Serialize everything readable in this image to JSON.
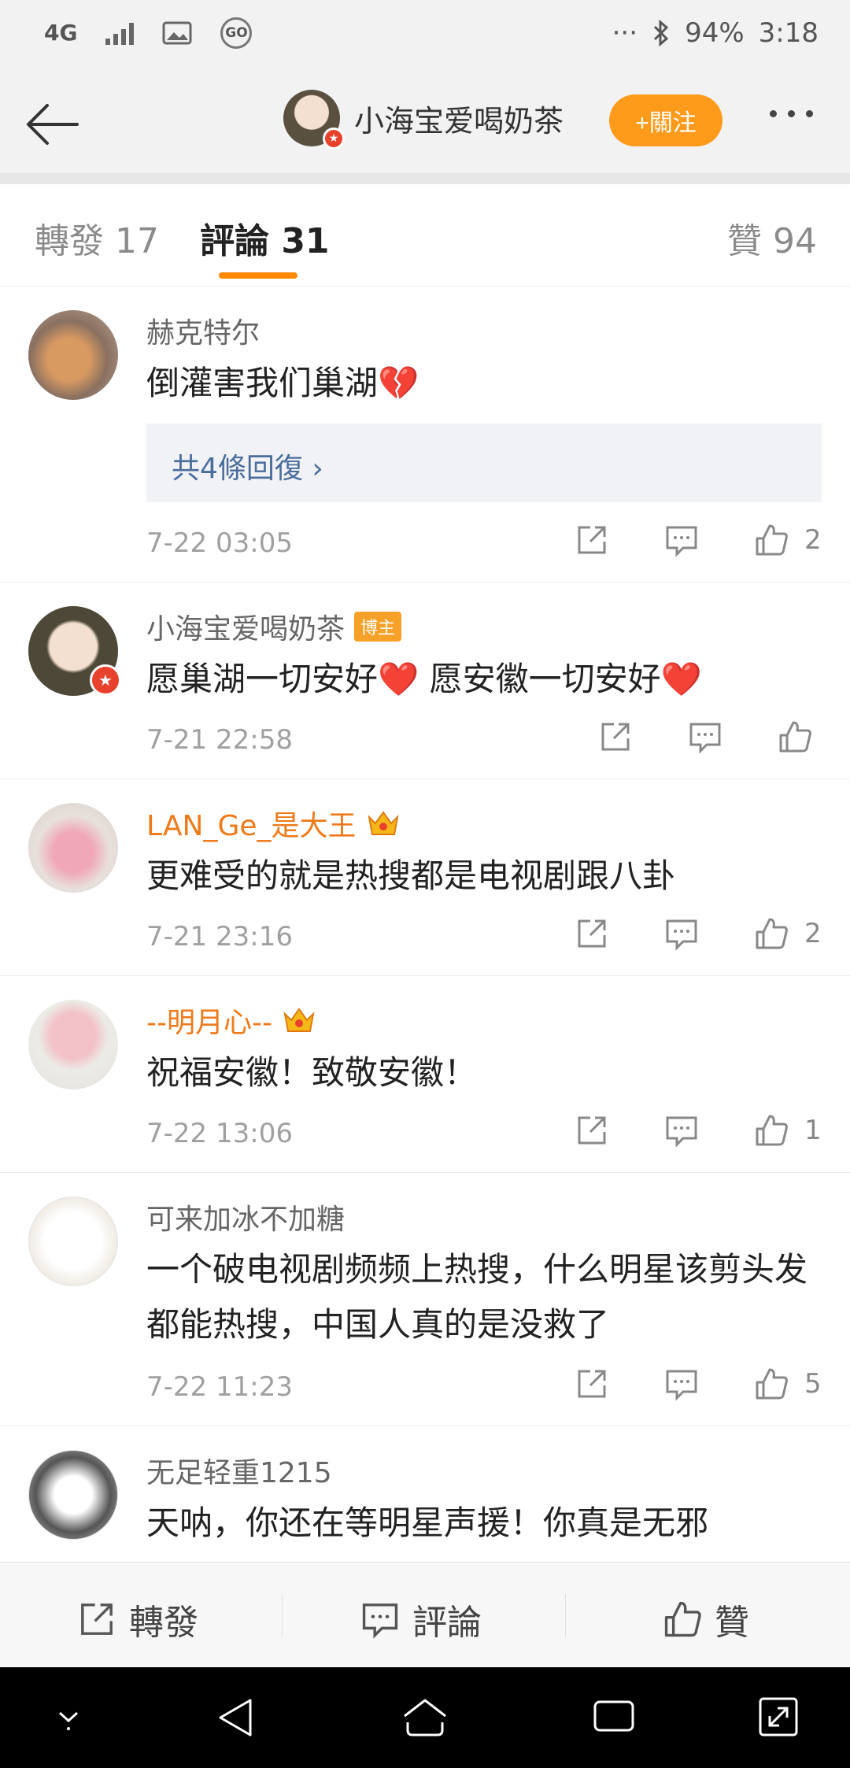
{
  "status_bar": {
    "network": "4G",
    "battery": "94%",
    "time": "3:18",
    "dots": "···",
    "go": "GO"
  },
  "header": {
    "title": "小海宝爱喝奶茶",
    "follow_label": "+關注"
  },
  "tabs": [
    {
      "label": "轉發 17"
    },
    {
      "label": "評論 31"
    },
    {
      "label": "贊 94"
    }
  ],
  "comments": [
    {
      "name": "赫克特尔",
      "text": "倒灌害我们巢湖💔",
      "reply_link": "共4條回復 ›",
      "time": "7-22 03:05",
      "likes": "2"
    },
    {
      "name": "小海宝爱喝奶茶",
      "badge": "博主",
      "text": "愿巢湖一切安好❤️ 愿安徽一切安好❤️",
      "time": "7-21 22:58",
      "likes": ""
    },
    {
      "name": "LAN_Ge_是大王",
      "text": "更难受的就是热搜都是电视剧跟八卦",
      "time": "7-21 23:16",
      "likes": "2"
    },
    {
      "name": "--明月心--",
      "text": "祝福安徽！致敬安徽！",
      "time": "7-22 13:06",
      "likes": "1"
    },
    {
      "name": "可来加冰不加糖",
      "text": "一个破电视剧频频上热搜，什么明星该剪头发都能热搜，中国人真的是没救了",
      "time": "7-22 11:23",
      "likes": "5"
    },
    {
      "name": "无足轻重1215",
      "text": "天呐，你还在等明星声援！你真是无邪"
    }
  ],
  "bottom_bar": {
    "repost": "轉發",
    "comment": "評論",
    "like": "贊"
  },
  "colors": {
    "accent": "#ff9a1a",
    "vip_name": "#ee7a1a",
    "link": "#4a6d9c"
  }
}
